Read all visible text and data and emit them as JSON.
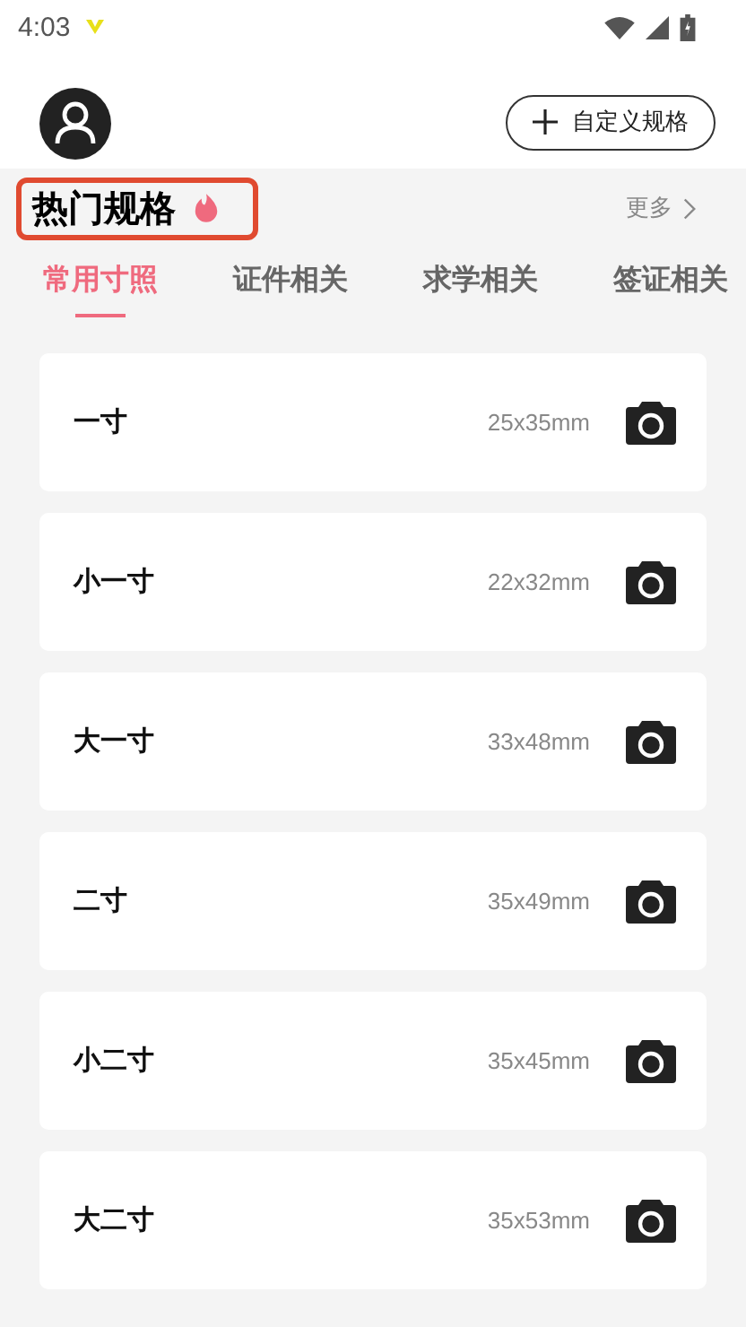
{
  "status_bar": {
    "time": "4:03"
  },
  "header": {
    "custom_button": "自定义规格"
  },
  "section": {
    "title": "热门规格",
    "highlighted": true,
    "more": "更多"
  },
  "tabs": [
    {
      "label": "常用寸照",
      "selected": true
    },
    {
      "label": "证件相关",
      "selected": false
    },
    {
      "label": "求学相关",
      "selected": false
    },
    {
      "label": "签证相关",
      "selected": false
    }
  ],
  "sizes": [
    {
      "name": "一寸",
      "dimensions": "25x35mm"
    },
    {
      "name": "小一寸",
      "dimensions": "22x32mm"
    },
    {
      "name": "大一寸",
      "dimensions": "33x48mm"
    },
    {
      "name": "二寸",
      "dimensions": "35x49mm"
    },
    {
      "name": "小二寸",
      "dimensions": "35x45mm"
    },
    {
      "name": "大二寸",
      "dimensions": "35x53mm"
    }
  ]
}
